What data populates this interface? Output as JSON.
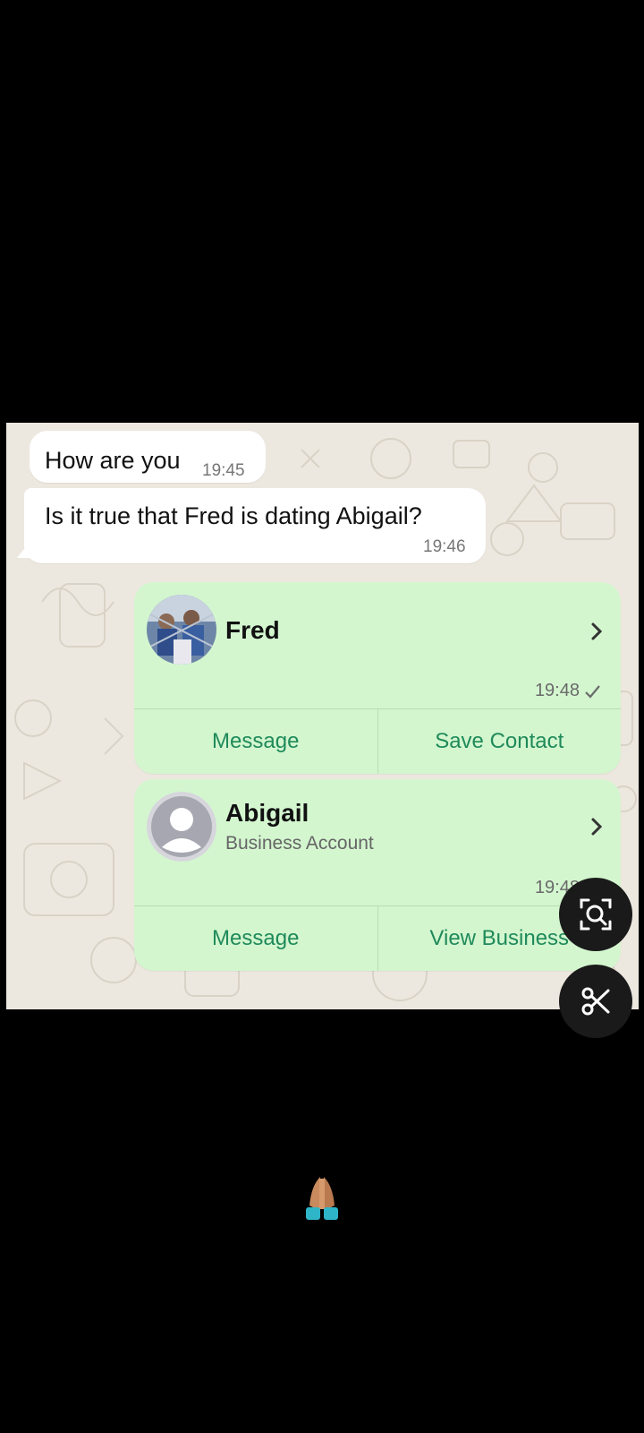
{
  "messages_in": [
    {
      "text": "How are you",
      "time": "19:45"
    },
    {
      "text": "Is it true that Fred is dating Abigail?",
      "time": "19:46"
    }
  ],
  "contact_cards": [
    {
      "name": "Fred",
      "subtitle": "",
      "time": "19:48",
      "status_icon": "check-icon",
      "actions": [
        "Message",
        "Save Contact"
      ]
    },
    {
      "name": "Abigail",
      "subtitle": "Business Account",
      "time": "19:48",
      "status_icon": "check-icon",
      "actions": [
        "Message",
        "View Business"
      ]
    }
  ],
  "overlay_buttons": [
    {
      "icon": "lens-search-icon"
    },
    {
      "icon": "scissors-icon"
    }
  ],
  "emoji": "folded-hands",
  "colors": {
    "background": "#000000",
    "chat_wallpaper": "#ede8df",
    "incoming_bubble": "#ffffff",
    "card_bg": "#d3f6cf",
    "action_text": "#1f8a5a"
  }
}
